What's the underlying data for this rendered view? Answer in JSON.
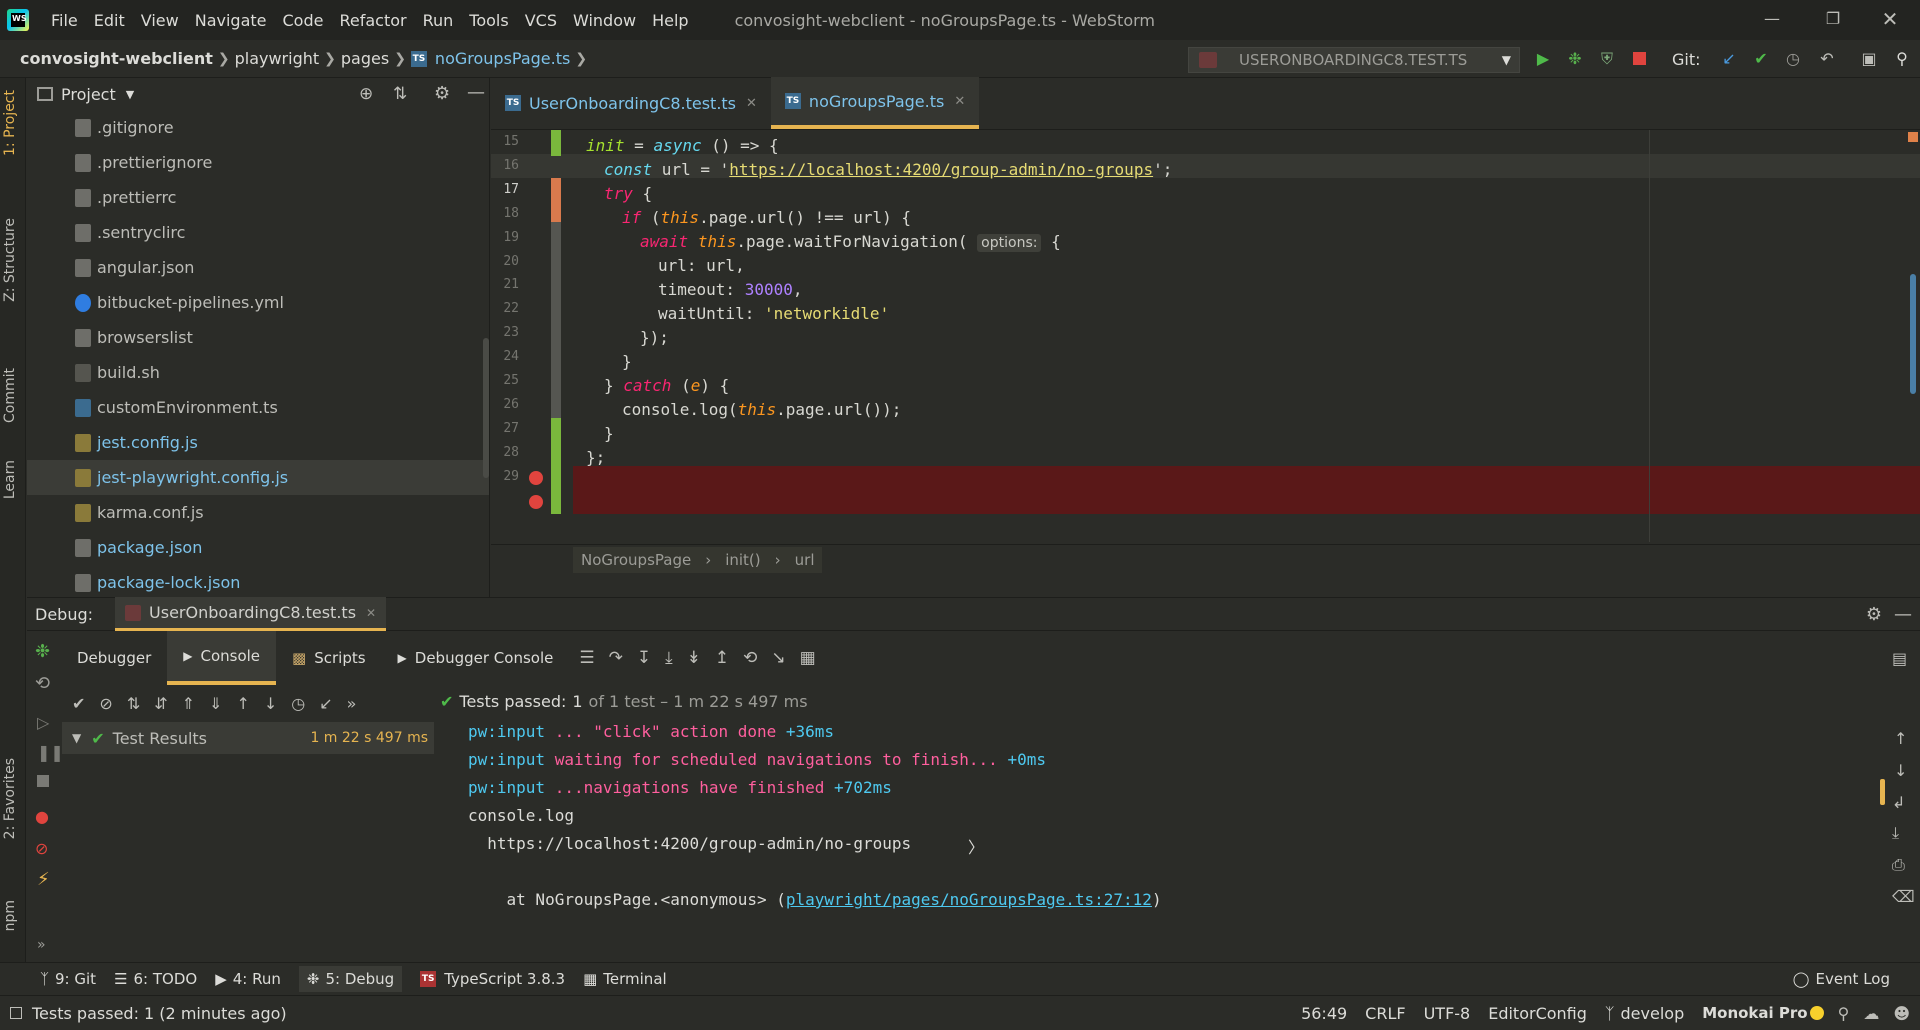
{
  "titlebar": {
    "menu": [
      "File",
      "Edit",
      "View",
      "Navigate",
      "Code",
      "Refactor",
      "Run",
      "Tools",
      "VCS",
      "Window",
      "Help"
    ],
    "title": "convosight-webclient - noGroupsPage.ts - WebStorm"
  },
  "navbar": {
    "breadcrumbs": [
      "convosight-webclient",
      "playwright",
      "pages",
      "noGroupsPage.ts"
    ],
    "run_config": "USERONBOARDINGC8.TEST.TS",
    "git_label": "Git:"
  },
  "left_tabs": [
    "1: Project",
    "Z: Structure",
    "Commit",
    "Learn",
    "2: Favorites",
    "npm"
  ],
  "project": {
    "title": "Project",
    "files": [
      {
        "name": ".gitignore",
        "color": "#bdbdb8",
        "icon": "file-icon"
      },
      {
        "name": ".prettierignore",
        "color": "#bdbdb8",
        "icon": "file-icon"
      },
      {
        "name": ".prettierrc",
        "color": "#bdbdb8",
        "icon": "file-icon"
      },
      {
        "name": ".sentryclirc",
        "color": "#bdbdb8",
        "icon": "file-icon"
      },
      {
        "name": "angular.json",
        "color": "#bdbdb8",
        "icon": "json-icon"
      },
      {
        "name": "bitbucket-pipelines.yml",
        "color": "#bdbdb8",
        "icon": "bitbucket-icon"
      },
      {
        "name": "browserslist",
        "color": "#bdbdb8",
        "icon": "file-icon"
      },
      {
        "name": "build.sh",
        "color": "#bdbdb8",
        "icon": "shell-icon"
      },
      {
        "name": "customEnvironment.ts",
        "color": "#bdbdb8",
        "icon": "ts-icon"
      },
      {
        "name": "jest.config.js",
        "color": "#7ec3ea",
        "icon": "js-icon"
      },
      {
        "name": "jest-playwright.config.js",
        "color": "#7ec3ea",
        "icon": "js-icon"
      },
      {
        "name": "karma.conf.js",
        "color": "#bdbdb8",
        "icon": "js-icon"
      },
      {
        "name": "package.json",
        "color": "#7ec3ea",
        "icon": "json-icon"
      },
      {
        "name": "package-lock.json",
        "color": "#7ec3ea",
        "icon": "json-icon"
      }
    ]
  },
  "editor": {
    "tabs": [
      {
        "label": "UserOnboardingC8.test.ts",
        "active": false
      },
      {
        "label": "noGroupsPage.ts",
        "active": true
      }
    ],
    "line_numbers": [
      "15",
      "16",
      "17",
      "18",
      "19",
      "20",
      "21",
      "22",
      "23",
      "24",
      "25",
      "26",
      "27",
      "28",
      "29"
    ],
    "breadcrumbs": [
      "NoGroupsPage",
      "init()",
      "url"
    ],
    "code": {
      "l16a": "init",
      "l16b": " = ",
      "l16c": "async",
      "l16d": " () => {",
      "l17a": "const",
      "l17b": " url = '",
      "l17c": "https://localhost:4200/group-admin/no-groups",
      "l17d": "';",
      "l18a": "try",
      "l18b": " {",
      "l19a": "if",
      "l19b": " (",
      "l19c": "this",
      "l19d": ".page.url() !== url) {",
      "l20a": "await",
      "l20b": " ",
      "l20c": "this",
      "l20d": ".page.waitForNavigation( ",
      "l20e": "options:",
      "l20f": " {",
      "l21a": "url: url,",
      "l22a": "timeout: ",
      "l22b": "30000",
      ",l22c": ",",
      "l23a": "waitUntil: ",
      "l23b": "'networkidle'",
      "l24a": "});",
      "l25a": "}",
      "l26a": "} ",
      "l26b": "catch",
      "l26c": " (",
      "l26d": "e",
      "l26e": ") {",
      "l27a": "console.log(",
      "l27b": "this",
      "l27c": ".page.url());",
      "l28a": "}",
      "l29a": "};"
    }
  },
  "debug": {
    "label": "Debug:",
    "session": "UserOnboardingC8.test.ts",
    "tabs": [
      "Debugger",
      "Console",
      "Scripts",
      "Debugger Console"
    ],
    "active_tab": "Console",
    "tests_passed_label": "Tests passed:",
    "tests_passed_count": "1",
    "tests_passed_rest": "of 1 test – 1 m 22 s 497 ms",
    "test_results": "Test Results",
    "test_results_time": "1 m 22 s 497 ms",
    "console": [
      {
        "a": "pw:input",
        "b": " ... \"click\" action done ",
        "c": "+36ms"
      },
      {
        "a": "pw:input",
        "b": " waiting for scheduled navigations to finish... ",
        "c": "+0ms"
      },
      {
        "a": "pw:input",
        "b": " ...navigations have finished ",
        "c": "+702ms"
      }
    ],
    "console_log": "console.log",
    "console_url": "  https://localhost:4200/group-admin/no-groups",
    "at_prefix": "    at NoGroupsPage.<anonymous> (",
    "at_link": "playwright/pages/noGroupsPage.ts:27:12",
    "at_suffix": ")"
  },
  "toolstrip": [
    "9: Git",
    "6: TODO",
    "4: Run",
    "5: Debug",
    "TypeScript 3.8.3",
    "Terminal"
  ],
  "event_log": "Event Log",
  "status": {
    "message": "Tests passed: 1 (2 minutes ago)",
    "position": "56:49",
    "line_sep": "CRLF",
    "encoding": "UTF-8",
    "editorconfig": "EditorConfig",
    "branch": "develop",
    "theme": "Monokai Pro"
  }
}
